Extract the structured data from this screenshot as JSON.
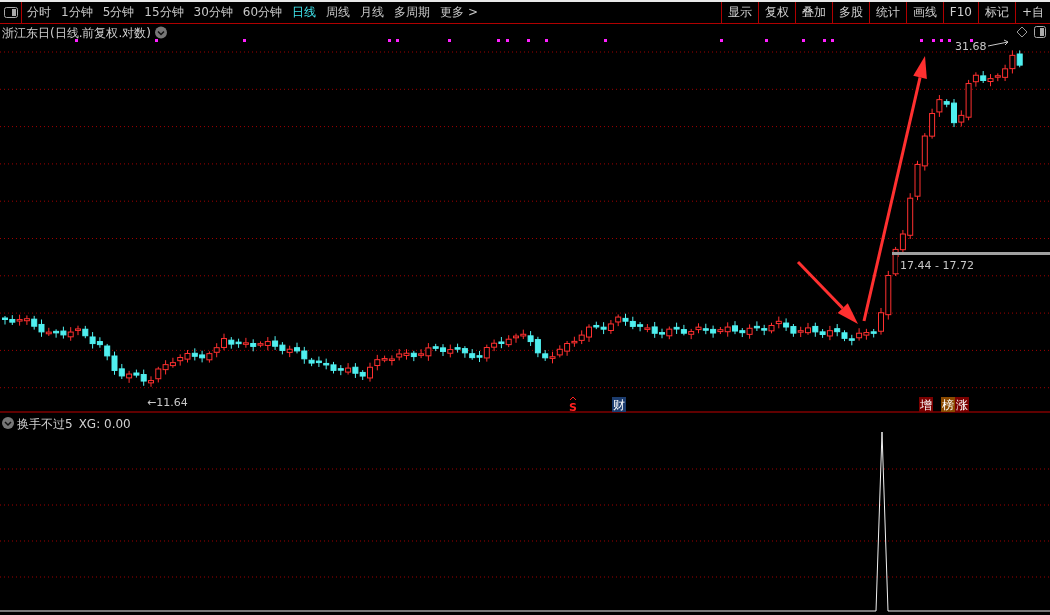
{
  "toolbar": {
    "tabs": [
      {
        "label": "分时",
        "selected": false
      },
      {
        "label": "1分钟",
        "selected": false
      },
      {
        "label": "5分钟",
        "selected": false
      },
      {
        "label": "15分钟",
        "selected": false
      },
      {
        "label": "30分钟",
        "selected": false
      },
      {
        "label": "60分钟",
        "selected": false
      },
      {
        "label": "日线",
        "selected": true
      },
      {
        "label": "周线",
        "selected": false
      },
      {
        "label": "月线",
        "selected": false
      },
      {
        "label": "多周期",
        "selected": false
      },
      {
        "label": "更多 >",
        "selected": false
      }
    ],
    "actions": [
      {
        "label": "显示"
      },
      {
        "label": "复权"
      },
      {
        "label": "叠加"
      },
      {
        "label": "多股"
      },
      {
        "label": "统计"
      },
      {
        "label": "画线"
      },
      {
        "label": "F10"
      },
      {
        "label": "标记"
      },
      {
        "label": "+自"
      }
    ]
  },
  "chart": {
    "title": "浙江东日(日线.前复权.对数)",
    "high_label": "31.68",
    "low_label": "←11.64",
    "range_label": "17.44 - 17.72",
    "event_marks": [
      {
        "label": "S",
        "kind": "text",
        "color": "#ff2020"
      },
      {
        "label": "财",
        "kind": "tag",
        "color": "#1c3c6e"
      },
      {
        "label": "增",
        "kind": "tag",
        "color": "#7a0000"
      },
      {
        "label": "榜",
        "kind": "tag",
        "color": "#8a4a00"
      },
      {
        "label": "涨",
        "kind": "tag",
        "color": "#7a0000"
      }
    ]
  },
  "indicator": {
    "name": "换手不过5",
    "reading": "XG: 0.00"
  }
}
